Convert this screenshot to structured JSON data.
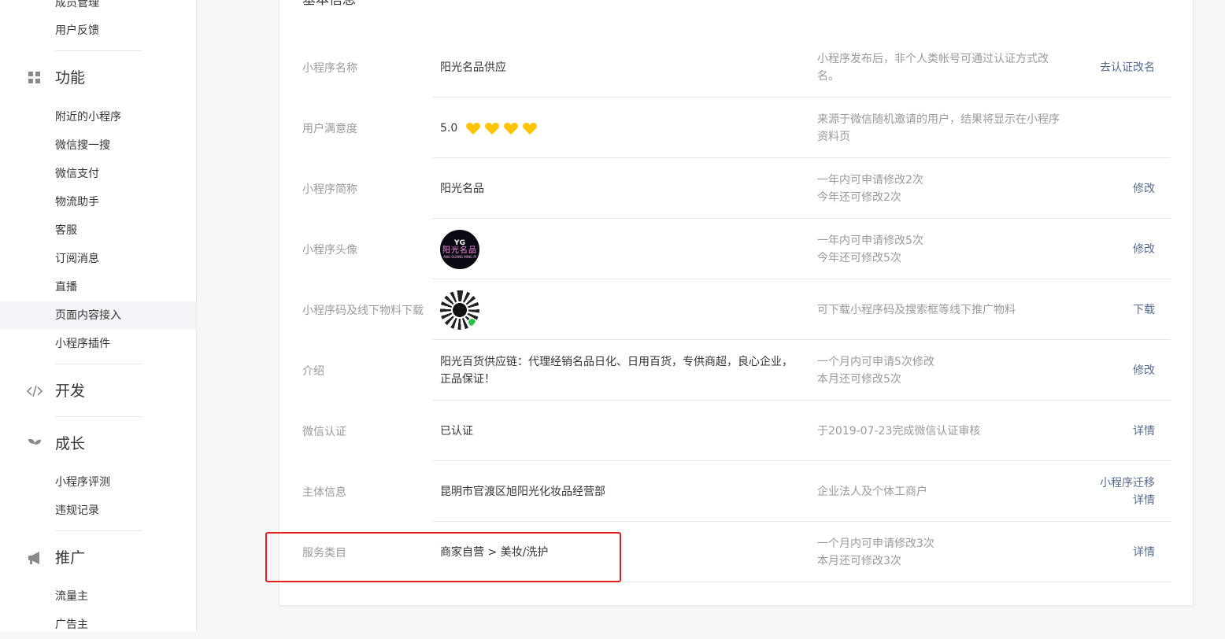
{
  "sidebar": {
    "top_items": [
      "成员管理",
      "用户反馈"
    ],
    "sections": [
      {
        "title": "功能",
        "icon": "grid-icon",
        "items": [
          "附近的小程序",
          "微信搜一搜",
          "微信支付",
          "物流助手",
          "客服",
          "订阅消息",
          "直播",
          "页面内容接入",
          "小程序插件"
        ]
      },
      {
        "title": "开发",
        "icon": "code-icon",
        "items": []
      },
      {
        "title": "成长",
        "icon": "sprout-icon",
        "items": [
          "小程序评测",
          "违规记录"
        ]
      },
      {
        "title": "推广",
        "icon": "megaphone-icon",
        "items": [
          "流量主",
          "广告主"
        ]
      }
    ],
    "active_item": "页面内容接入"
  },
  "main": {
    "section_title": "基本信息",
    "rows": [
      {
        "label": "小程序名称",
        "value": "阳光名品供应",
        "desc": [
          "小程序发布后，非个人类帐号可通过认证方式改",
          "名。"
        ],
        "actions": [
          "去认证改名"
        ]
      },
      {
        "label": "用户满意度",
        "value": "5.0",
        "rating": 4,
        "desc": [
          "来源于微信随机邀请的用户，结果将显示在小程序",
          "资料页"
        ],
        "actions": []
      },
      {
        "label": "小程序简称",
        "value": "阳光名品",
        "desc": [
          "一年内可申请修改2次",
          "今年还可修改2次"
        ],
        "actions": [
          "修改"
        ]
      },
      {
        "label": "小程序头像",
        "avatar": {
          "top": "YG",
          "main": "阳光名品",
          "sub": "ANG GUANG MING PI"
        },
        "desc": [
          "一年内可申请修改5次",
          "今年还可修改5次"
        ],
        "actions": [
          "修改"
        ]
      },
      {
        "label": "小程序码及线下物料下载",
        "desc": [
          "可下载小程序码及搜索框等线下推广物料"
        ],
        "actions": [
          "下载"
        ]
      },
      {
        "label": "介绍",
        "value": "阳光百货供应链：代理经销名品日化、日用百货，专供商超，良心企业，正品保证！",
        "desc": [
          "一个月内可申请5次修改",
          "本月还可修改5次"
        ],
        "actions": [
          "修改"
        ]
      },
      {
        "label": "微信认证",
        "value": "已认证",
        "desc": [
          "于2019-07-23完成微信认证审核"
        ],
        "actions": [
          "详情"
        ]
      },
      {
        "label": "主体信息",
        "value": "昆明市官渡区旭阳光化妆品经营部",
        "desc": [
          "企业法人及个体工商户"
        ],
        "actions": [
          "小程序迁移",
          "详情"
        ]
      },
      {
        "label": "服务类目",
        "value": "商家自营 > 美妆/洗护",
        "desc": [
          "一个月内可申请修改3次",
          "本月还可修改3次"
        ],
        "actions": [
          "详情"
        ]
      }
    ]
  },
  "colors": {
    "link": "#576b95",
    "label": "#9a9a9a",
    "heart": "#ffc300",
    "highlight": "#e61e1e"
  }
}
